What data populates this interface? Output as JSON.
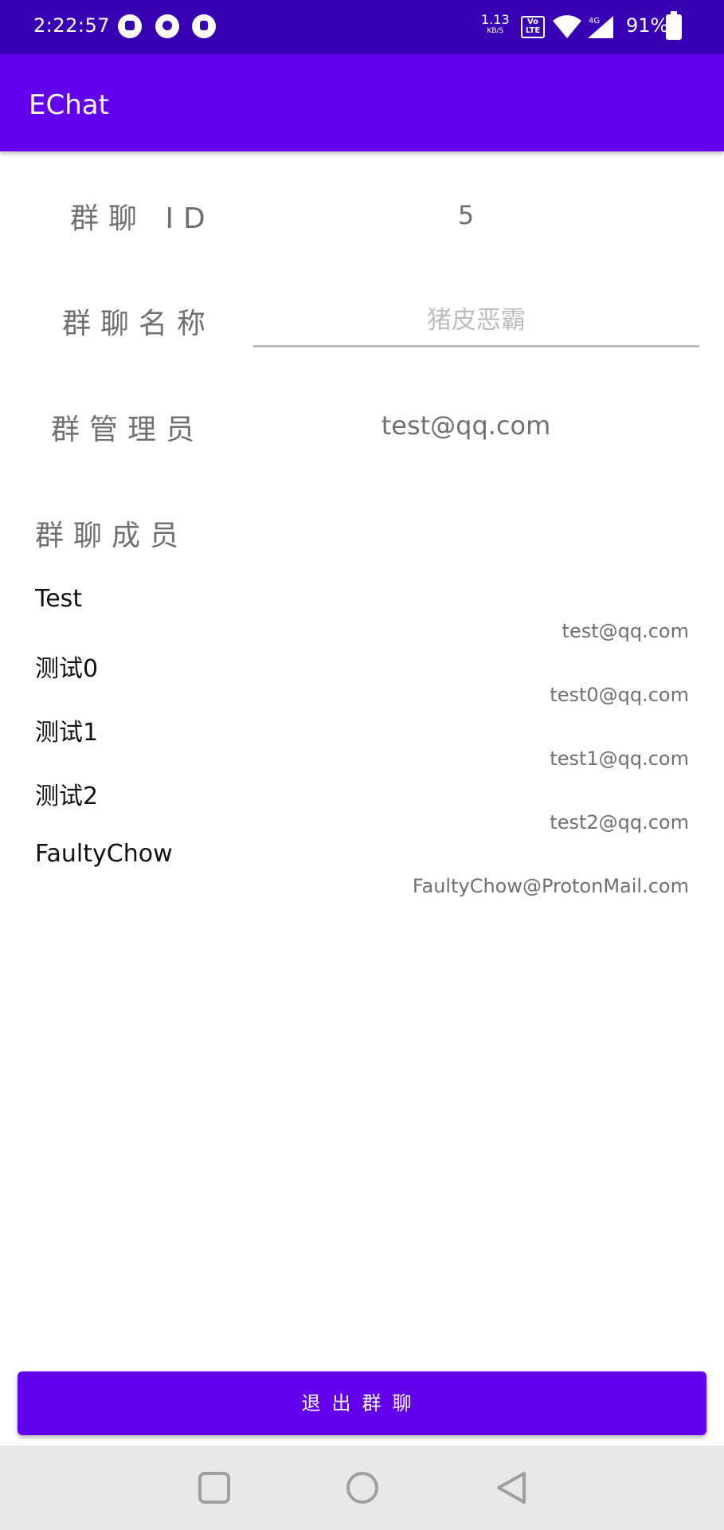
{
  "status_bar": {
    "time": "2:22:57",
    "net_speed": "1.13",
    "net_speed_unit": "KB/S",
    "volte": "Vo LTE",
    "network": "4G",
    "battery": "91%"
  },
  "app_bar": {
    "title": "EChat"
  },
  "group_info": {
    "id_label": "群聊 ID",
    "id_value": "5",
    "name_label": "群聊名称",
    "name_placeholder": "猪皮恶霸",
    "admin_label": "群管理员",
    "admin_value": "test@qq.com",
    "members_label": "群聊成员"
  },
  "members": [
    {
      "name": "Test",
      "email": "test@qq.com"
    },
    {
      "name": "测试0",
      "email": "test0@qq.com"
    },
    {
      "name": "测试1",
      "email": "test1@qq.com"
    },
    {
      "name": "测试2",
      "email": "test2@qq.com"
    },
    {
      "name": "FaultyChow",
      "email": "FaultyChow@ProtonMail.com"
    }
  ],
  "actions": {
    "quit_label": "退出群聊"
  },
  "colors": {
    "status_bar": "#3700b3",
    "primary": "#6200ee",
    "text_gray": "#707070"
  }
}
